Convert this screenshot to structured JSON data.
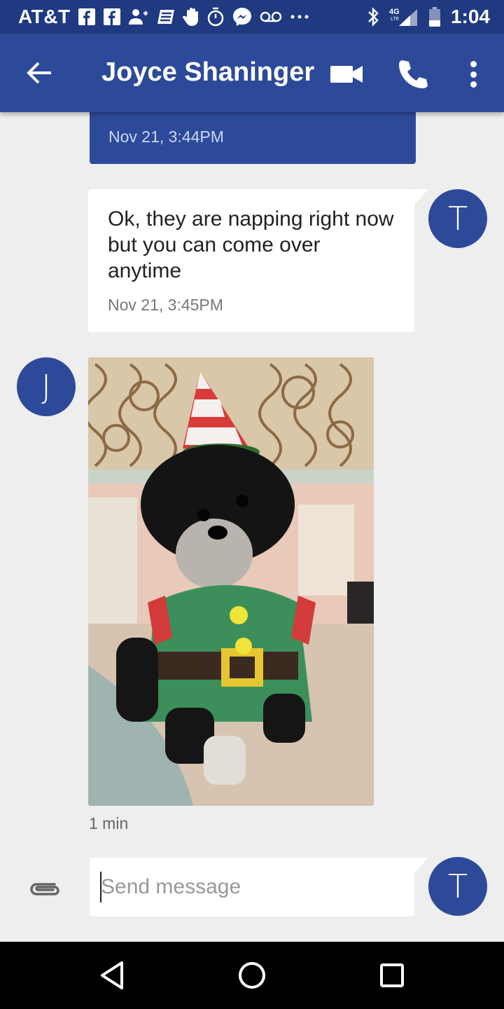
{
  "status_bar": {
    "carrier": "AT&T",
    "network": "4G LTE",
    "time": "1:04",
    "icons": [
      "facebook-icon",
      "facebook-icon",
      "add-person-icon",
      "news-icon",
      "hand-icon",
      "stopwatch-icon",
      "messenger-icon",
      "voicemail-icon",
      "more-dots-icon",
      "bluetooth-icon",
      "signal-icon",
      "battery-icon"
    ]
  },
  "app_bar": {
    "title": "Joyce Shaninger",
    "back_icon": "arrow-left-icon",
    "video_icon": "video-camera-icon",
    "call_icon": "phone-icon",
    "menu_icon": "more-vert-icon"
  },
  "messages": [
    {
      "direction": "outgoing",
      "text": "",
      "timestamp": "Nov 21, 3:44PM"
    },
    {
      "direction": "incoming",
      "sender_initial": "T",
      "text": "Ok, they are napping right now but you can come over anytime",
      "timestamp": "Nov 21, 3:45PM"
    },
    {
      "direction": "incoming-photo",
      "sender_initial": "J",
      "timestamp": "1 min"
    }
  ],
  "compose": {
    "placeholder": "Send message",
    "value": "",
    "sender_initial": "T",
    "attach_icon": "paperclip-icon"
  },
  "nav_bar": {
    "back_icon": "nav-back-icon",
    "home_icon": "nav-home-icon",
    "recents_icon": "nav-recents-icon"
  },
  "colors": {
    "status_bar": "#1f3a80",
    "app_bar": "#2d4a9a",
    "background": "#eeeeee",
    "avatar": "#2d4a9a"
  }
}
